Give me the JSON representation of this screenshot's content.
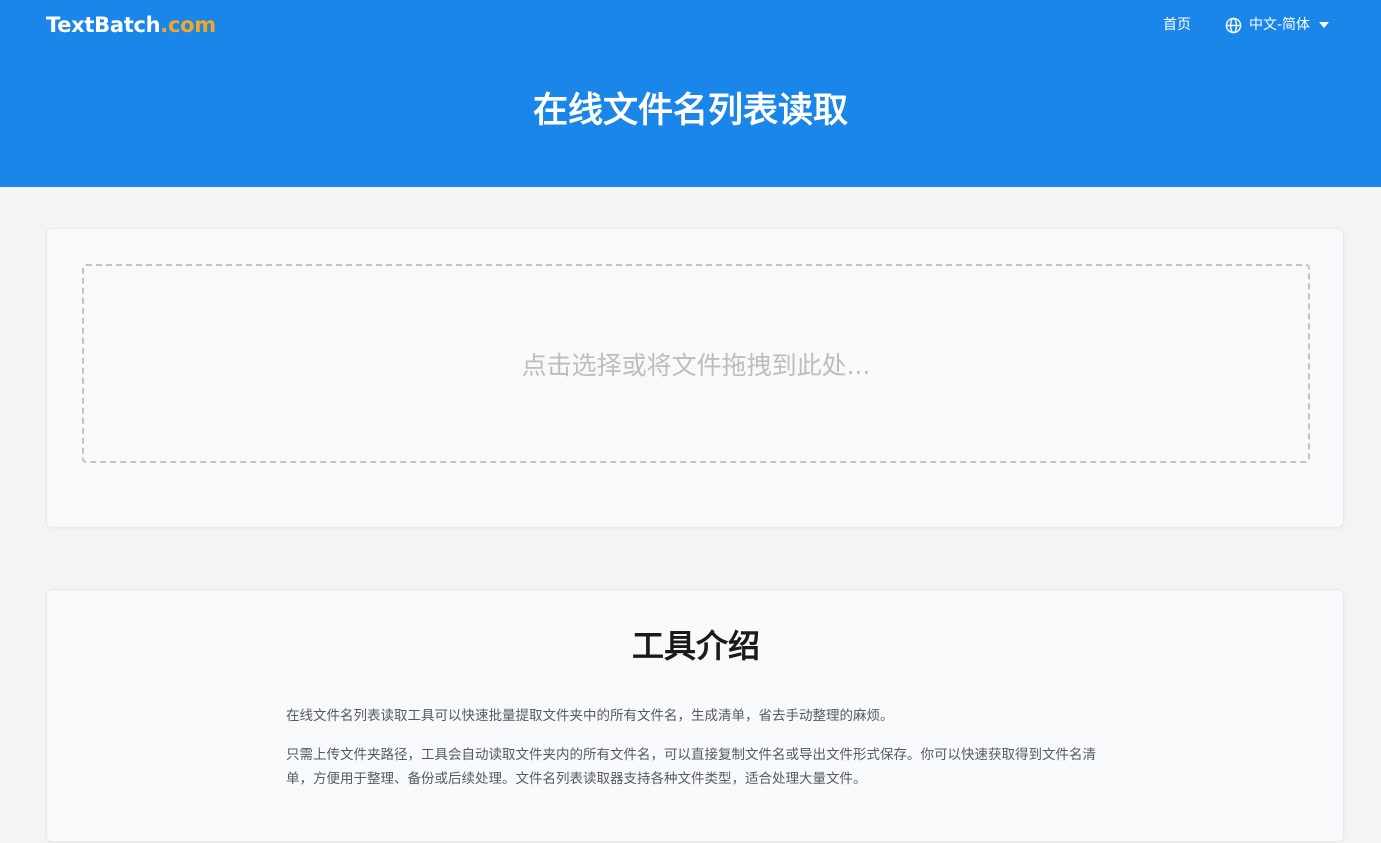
{
  "header": {
    "logo_main": "TextBatch",
    "logo_tld": ".com",
    "nav_home": "首页",
    "language": "中文-简体",
    "title": "在线文件名列表读取"
  },
  "upload": {
    "placeholder": "点击选择或将文件拖拽到此处..."
  },
  "intro": {
    "title": "工具介绍",
    "paragraph_1": "在线文件名列表读取工具可以快速批量提取文件夹中的所有文件名，生成清单，省去手动整理的麻烦。",
    "paragraph_2": "只需上传文件夹路径，工具会自动读取文件夹内的所有文件名，可以直接复制文件名或导出文件形式保存。你可以快速获取得到文件名清单，方便用于整理、备份或后续处理。文件名列表读取器支持各种文件类型，适合处理大量文件。"
  },
  "icons": {
    "language": "globe-icon",
    "dropdown": "chevron-down-icon"
  },
  "colors": {
    "brand_blue": "#1a86ea",
    "logo_accent": "#f6a623",
    "page_bg": "#f4f4f4",
    "card_bg": "#f8f9fb"
  }
}
